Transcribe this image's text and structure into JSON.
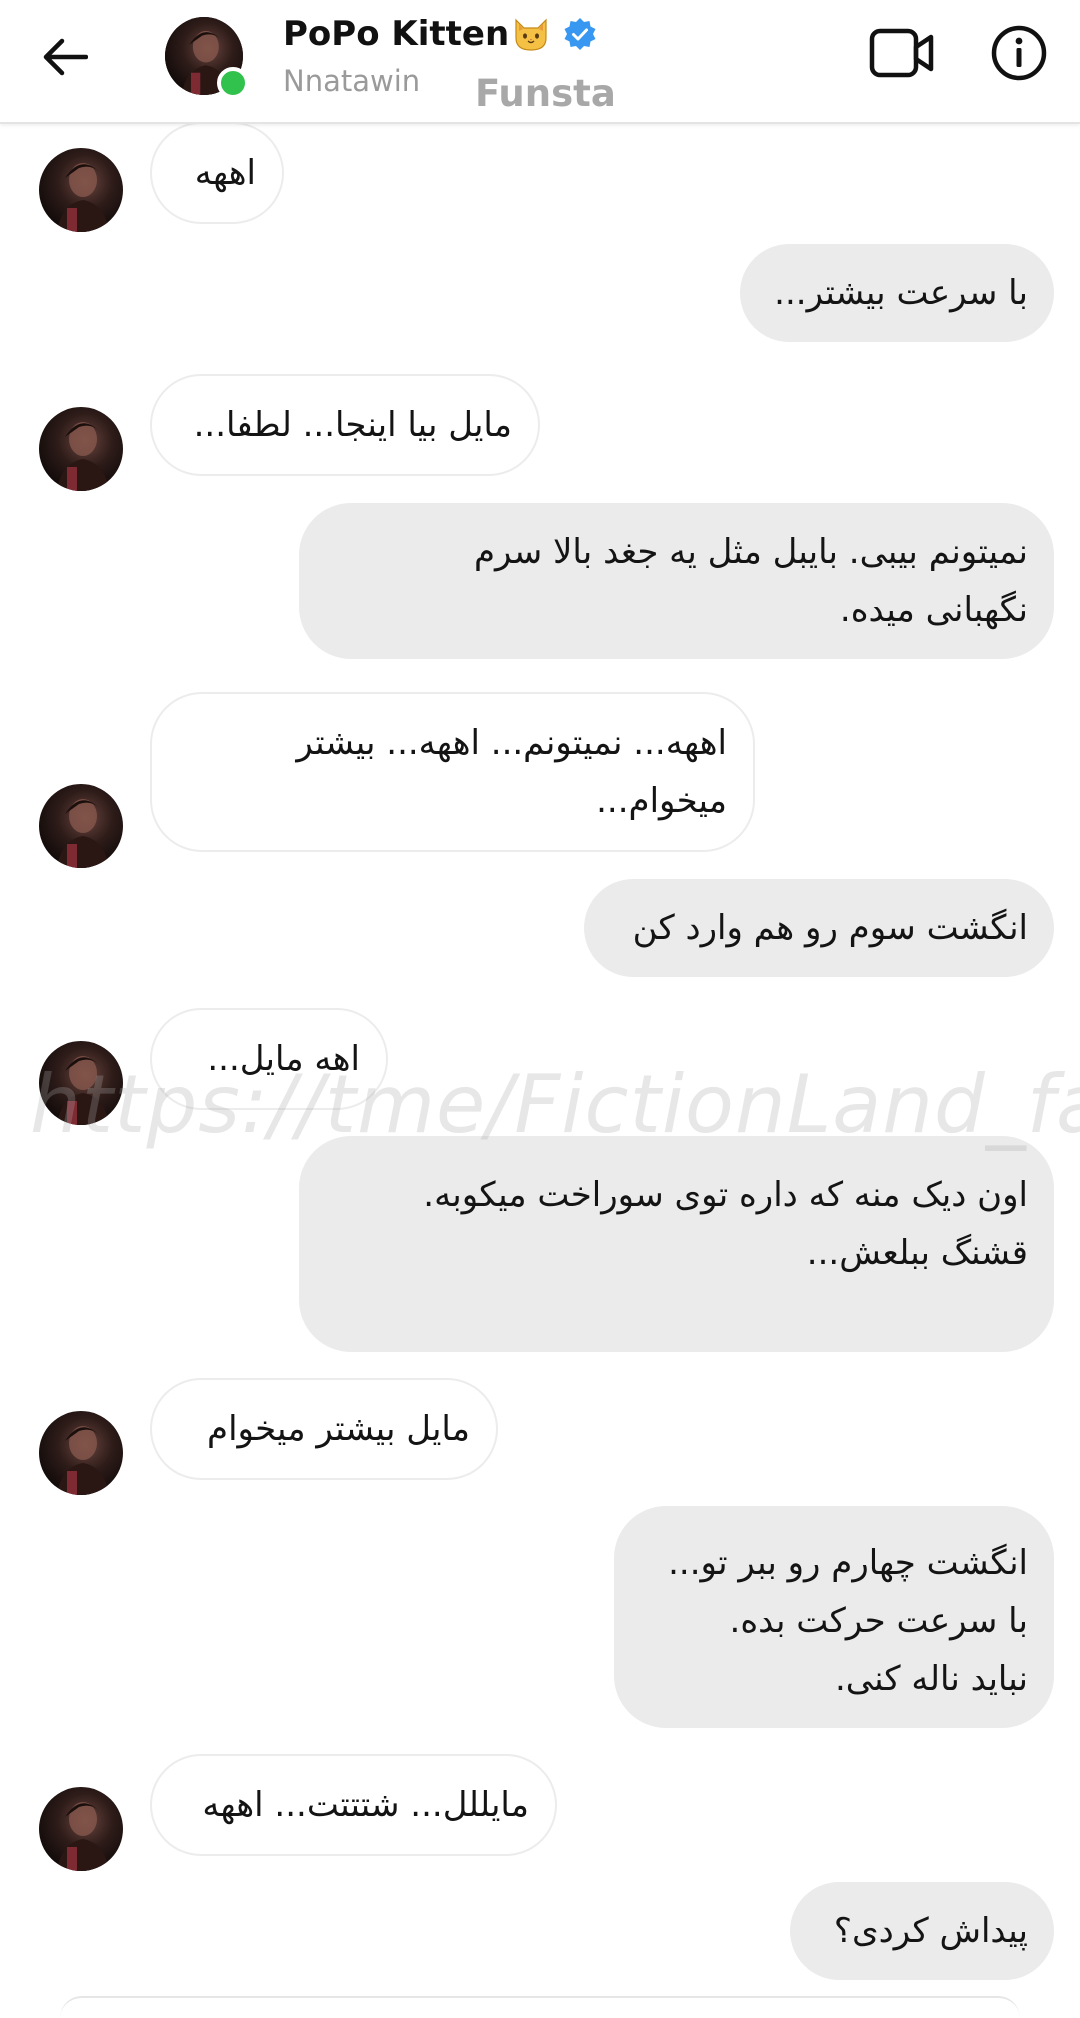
{
  "header": {
    "name": "PoPo Kitten",
    "username": "Nnatawin",
    "tag": "Funsta",
    "online": true,
    "accent_verified": "#3897f0",
    "online_color": "#31c24d"
  },
  "icons": {
    "back": "arrow-left-icon",
    "video": "video-camera-icon",
    "info": "info-circle-icon",
    "verified": "verified-badge-icon",
    "cat": "cat-face-emoji"
  },
  "colors": {
    "incoming_bubble": "#ffffff",
    "outgoing_bubble": "#ebebeb"
  },
  "watermark": "https://tme/FictionLand_farsi",
  "messages": [
    {
      "direction": "in",
      "lines": [
        "اههه"
      ]
    },
    {
      "direction": "out",
      "lines": [
        "با سرعت بیشتر..."
      ]
    },
    {
      "direction": "in",
      "lines": [
        "مایل بیا اینجا... لطفا..."
      ]
    },
    {
      "direction": "out",
      "lines": [
        "نمیتونم بیبی. بایبل مثل یه جغد بالا سرم",
        "نگهبانی میده."
      ]
    },
    {
      "direction": "in",
      "lines": [
        "اههه... نمیتونم... اههه... بیشتر",
        "میخوام..."
      ]
    },
    {
      "direction": "out",
      "lines": [
        "انگشت سوم رو هم وارد کن"
      ]
    },
    {
      "direction": "in",
      "lines": [
        "اهه مایل..."
      ]
    },
    {
      "direction": "out",
      "lines": [
        "اون دیک منه که داره توی سوراخت میکوبه.",
        "قشنگ ببلعش..."
      ]
    },
    {
      "direction": "in",
      "lines": [
        "مایل بیشتر میخوام"
      ]
    },
    {
      "direction": "out",
      "lines": [
        "انگشت چهارم رو ببر تو...",
        "با سرعت حرکت بده.",
        "نباید ناله کنی."
      ]
    },
    {
      "direction": "in",
      "lines": [
        "مایللل... شتتتت... اههه"
      ]
    },
    {
      "direction": "out",
      "lines": [
        "پیداش کردی؟"
      ]
    }
  ]
}
